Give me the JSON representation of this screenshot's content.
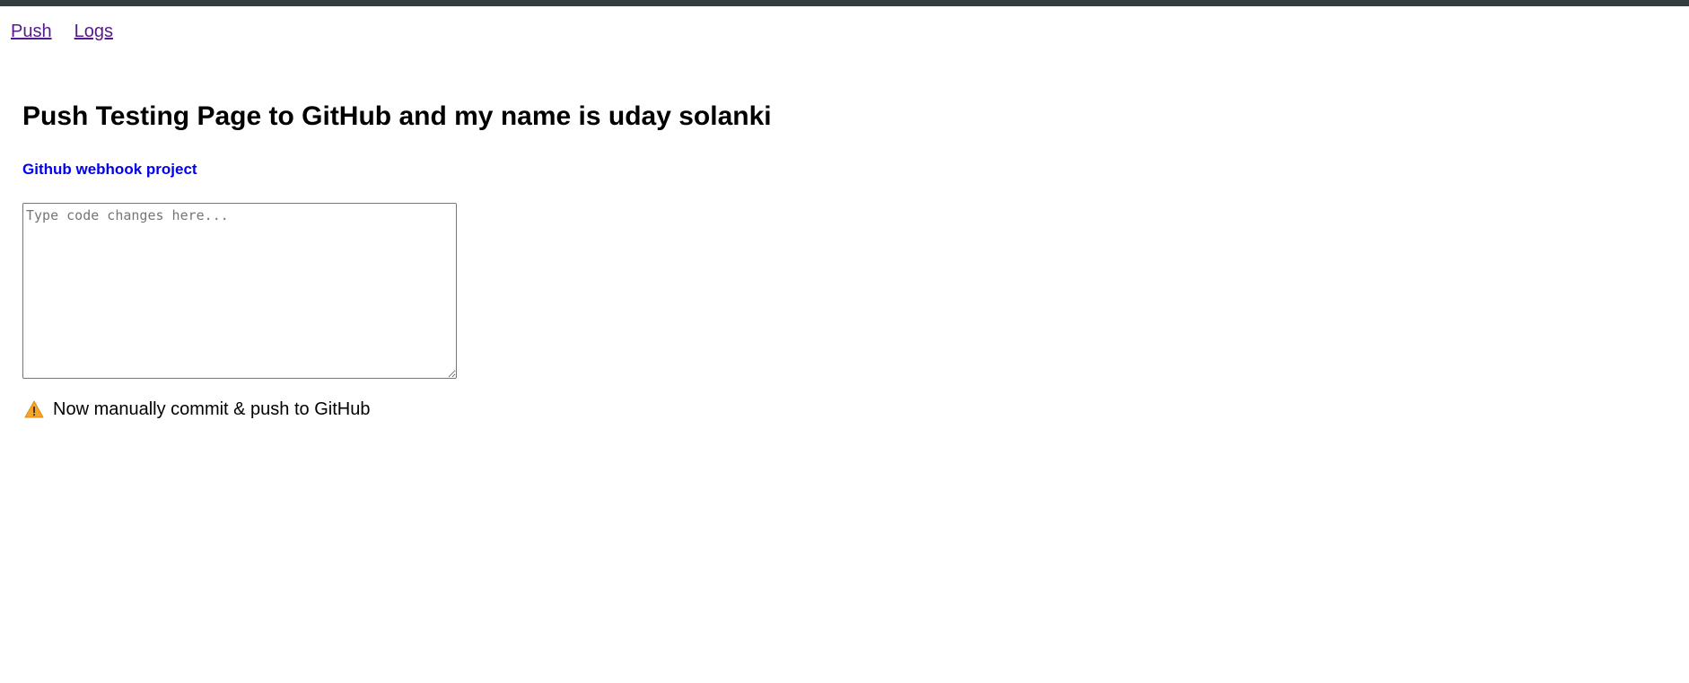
{
  "nav": {
    "items": [
      {
        "label": "Push"
      },
      {
        "label": "Logs"
      }
    ]
  },
  "main": {
    "title": "Push Testing Page to GitHub and my name is uday solanki",
    "project_link": "Github webhook project",
    "code_input": {
      "value": "",
      "placeholder": "Type code changes here..."
    },
    "notice": {
      "icon": "warning-icon",
      "text": "Now manually commit & push to GitHub"
    }
  },
  "colors": {
    "top_bar": "#333d3e",
    "link_visited": "#551a8b",
    "link": "#0000ee",
    "warning": "#f4a62a"
  }
}
